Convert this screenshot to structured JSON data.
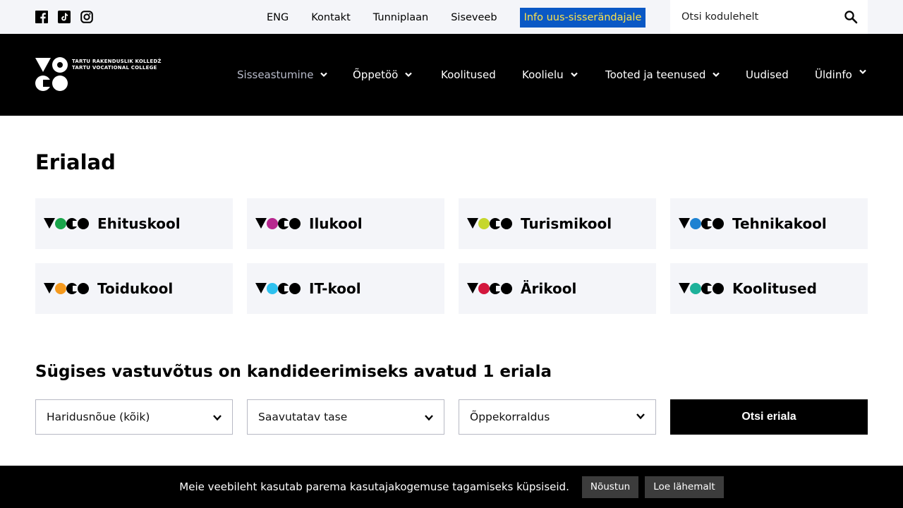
{
  "topbar": {
    "social": [
      {
        "icon": "facebook-icon"
      },
      {
        "icon": "tiktok-icon"
      },
      {
        "icon": "instagram-icon"
      }
    ],
    "links": [
      "ENG",
      "Kontakt",
      "Tunniplaan",
      "Siseveeb"
    ],
    "highlight_link": "Info uus-sisserändajale",
    "search_placeholder": "Otsi kodulehelt"
  },
  "logo": {
    "line1": "TARTU RAKENDUSLIK KOLLEDŽ",
    "line2": "TARTU VOCATIONAL COLLEGE"
  },
  "nav": {
    "items": [
      {
        "label": "Sisseastumine",
        "dropdown": true,
        "active": true
      },
      {
        "label": "Õppetöö",
        "dropdown": true
      },
      {
        "label": "Koolitused",
        "dropdown": false
      },
      {
        "label": "Koolielu",
        "dropdown": true
      },
      {
        "label": "Tooted ja teenused",
        "dropdown": true
      },
      {
        "label": "Uudised",
        "dropdown": false
      },
      {
        "label": "Üldinfo",
        "dropdown": true
      }
    ]
  },
  "main": {
    "title": "Erialad",
    "schools": [
      {
        "label": "Ehituskool",
        "color": "#1aa54b"
      },
      {
        "label": "Ilukool",
        "color": "#b7278f"
      },
      {
        "label": "Turismikool",
        "color": "#c6d72c"
      },
      {
        "label": "Tehnikakool",
        "color": "#1d82d2"
      },
      {
        "label": "Toidukool",
        "color": "#f59a1f"
      },
      {
        "label": "IT-kool",
        "color": "#2ec1ef"
      },
      {
        "label": "Ärikool",
        "color": "#d3173d"
      },
      {
        "label": "Koolitused",
        "color": "#1db19a"
      }
    ],
    "subtitle": "Sügises vastuvõtus on kandideerimiseks avatud 1 eriala",
    "filters": [
      "Haridusnõue (kõik)",
      "Saavutatav tase",
      "Õppekorraldus"
    ],
    "search_button": "Otsi eriala"
  },
  "cookie": {
    "text": "Meie veebileht kasutab parema kasutajakogemuse tagamiseks küpsiseid.",
    "accept": "Nõustun",
    "more": "Loe lähemalt"
  },
  "colors": {
    "highlight_bg": "#0a58c5",
    "highlight_text": "#fde34b",
    "card_bg": "#f4f5f9"
  }
}
